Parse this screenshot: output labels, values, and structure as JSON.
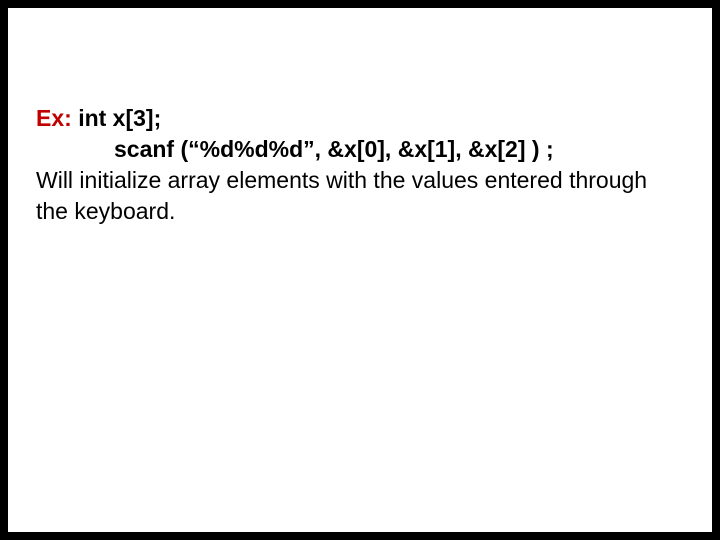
{
  "example": {
    "label": "Ex:",
    "declaration": "int  x[3];",
    "scanf_call": "scanf (“%d%d%d”, &x[0], &x[1], &x[2] ) ;"
  },
  "explanation": "Will initialize array elements with the values entered through the keyboard."
}
